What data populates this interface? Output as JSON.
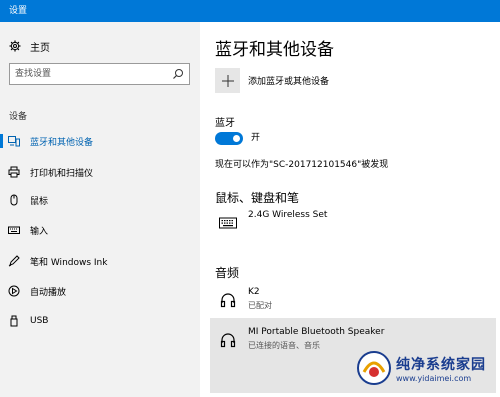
{
  "window": {
    "title": "设置"
  },
  "sidebar": {
    "home_label": "主页",
    "search_placeholder": "查找设置",
    "section_label": "设备",
    "items": [
      {
        "label": "蓝牙和其他设备",
        "icon": "bluetooth-devices-icon",
        "active": true
      },
      {
        "label": "打印机和扫描仪",
        "icon": "printer-icon",
        "active": false
      },
      {
        "label": "鼠标",
        "icon": "mouse-icon",
        "active": false
      },
      {
        "label": "输入",
        "icon": "keyboard-icon",
        "active": false
      },
      {
        "label": "笔和 Windows Ink",
        "icon": "pen-icon",
        "active": false
      },
      {
        "label": "自动播放",
        "icon": "autoplay-icon",
        "active": false
      },
      {
        "label": "USB",
        "icon": "usb-icon",
        "active": false
      }
    ]
  },
  "main": {
    "title": "蓝牙和其他设备",
    "add_device_label": "添加蓝牙或其他设备",
    "bluetooth": {
      "label": "蓝牙",
      "state": "开",
      "enabled": true,
      "discoverable_text": "现在可以作为\"SC-201712101546\"被发现"
    },
    "mouse_keyboard_pen": {
      "heading": "鼠标、键盘和笔",
      "devices": [
        {
          "name": "2.4G Wireless Set",
          "icon": "keyboard-device-icon"
        }
      ]
    },
    "audio": {
      "heading": "音频",
      "devices": [
        {
          "name": "K2",
          "status": "已配对",
          "icon": "headphones-icon"
        },
        {
          "name": "MI Portable Bluetooth Speaker",
          "status": "已连接的语音、音乐",
          "icon": "headphones-icon"
        }
      ]
    }
  },
  "watermark": {
    "text_cn": "纯净系统家园",
    "url": "www.yidaimei.com"
  },
  "colors": {
    "accent": "#0078d7",
    "sidebar_bg": "#f2f2f2",
    "selected_bg": "#e5e5e5"
  }
}
